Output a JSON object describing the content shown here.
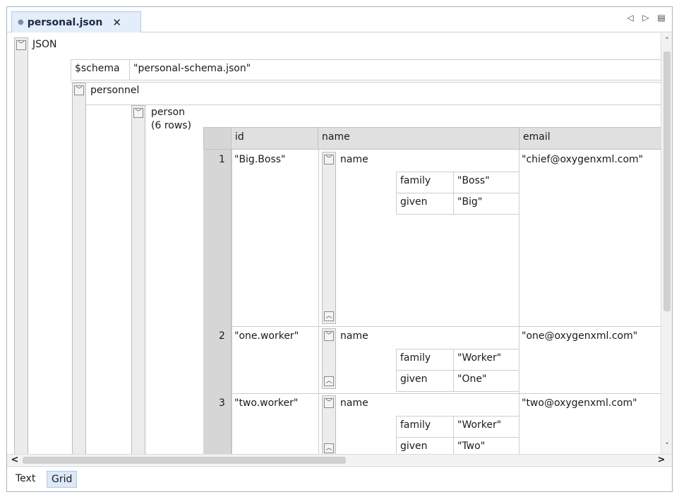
{
  "tab": {
    "filename": "personal.json",
    "close": "✕"
  },
  "tab_nav": {
    "prev": "◁",
    "next": "▷",
    "menu": "▤"
  },
  "grid": {
    "root_label": "JSON",
    "schema_key": "$schema",
    "schema_value": "\"personal-schema.json\"",
    "personnel_label": "personnel",
    "person_label": "person",
    "person_rows": "(6 rows)",
    "columns": [
      "id",
      "name",
      "email"
    ],
    "rows": [
      {
        "num": "1",
        "id": "\"Big.Boss\"",
        "name_label": "name",
        "family_key": "family",
        "family": "\"Boss\"",
        "given_key": "given",
        "given": "\"Big\"",
        "email": "\"chief@oxygenxml.com\""
      },
      {
        "num": "2",
        "id": "\"one.worker\"",
        "name_label": "name",
        "family_key": "family",
        "family": "\"Worker\"",
        "given_key": "given",
        "given": "\"One\"",
        "email": "\"one@oxygenxml.com\""
      },
      {
        "num": "3",
        "id": "\"two.worker\"",
        "name_label": "name",
        "family_key": "family",
        "family": "\"Worker\"",
        "given_key": "given",
        "given": "\"Two\"",
        "email": "\"two@oxygenxml.com\""
      }
    ]
  },
  "scroll": {
    "up": "˄",
    "down": "˅",
    "left": "<",
    "right": ">"
  },
  "modes": {
    "text": "Text",
    "grid": "Grid"
  },
  "colors": {
    "tab_bg": "#e4eefb",
    "header_bg": "#e0e0e0",
    "rownum_bg": "#d6d6d6",
    "mode_active": "#dbe8f8"
  }
}
